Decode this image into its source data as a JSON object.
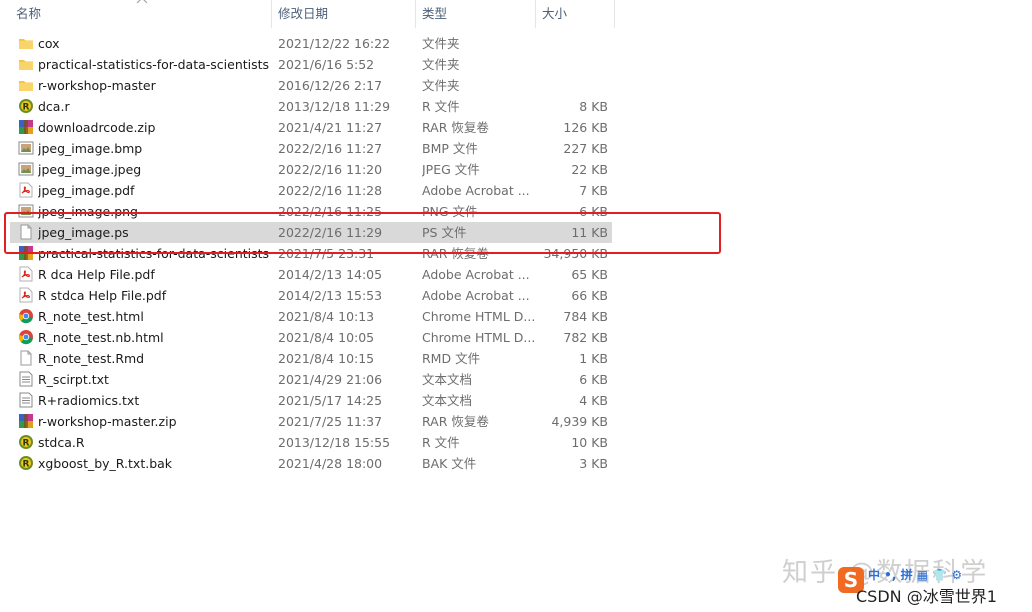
{
  "header": {
    "col_name": "名称",
    "col_date": "修改日期",
    "col_type": "类型",
    "col_size": "大小"
  },
  "files": [
    {
      "name": "cox",
      "date": "2021/12/22 16:22",
      "type": "文件夹",
      "size": "",
      "icon": "folder-icon"
    },
    {
      "name": "practical-statistics-for-data-scientists...",
      "date": "2021/6/16 5:52",
      "type": "文件夹",
      "size": "",
      "icon": "folder-icon"
    },
    {
      "name": "r-workshop-master",
      "date": "2016/12/26 2:17",
      "type": "文件夹",
      "size": "",
      "icon": "folder-icon"
    },
    {
      "name": "dca.r",
      "date": "2013/12/18 11:29",
      "type": "R 文件",
      "size": "8 KB",
      "icon": "r-file-icon"
    },
    {
      "name": "downloadrcode.zip",
      "date": "2021/4/21 11:27",
      "type": "RAR 恢复卷",
      "size": "126 KB",
      "icon": "rar-archive-icon"
    },
    {
      "name": "jpeg_image.bmp",
      "date": "2022/2/16 11:27",
      "type": "BMP 文件",
      "size": "227 KB",
      "icon": "image-file-icon"
    },
    {
      "name": "jpeg_image.jpeg",
      "date": "2022/2/16 11:20",
      "type": "JPEG 文件",
      "size": "22 KB",
      "icon": "image-file-icon"
    },
    {
      "name": "jpeg_image.pdf",
      "date": "2022/2/16 11:28",
      "type": "Adobe Acrobat ...",
      "size": "7 KB",
      "icon": "pdf-file-icon"
    },
    {
      "name": "jpeg_image.png",
      "date": "2022/2/16 11:25",
      "type": "PNG 文件",
      "size": "6 KB",
      "icon": "image-file-icon"
    },
    {
      "name": "jpeg_image.ps",
      "date": "2022/2/16 11:29",
      "type": "PS 文件",
      "size": "11 KB",
      "icon": "blank-file-icon",
      "selected": true
    },
    {
      "name": "practical-statistics-for-data-scientists...",
      "date": "2021/7/5 23:31",
      "type": "RAR 恢复卷",
      "size": "34,950 KB",
      "icon": "rar-archive-icon"
    },
    {
      "name": "R dca Help File.pdf",
      "date": "2014/2/13 14:05",
      "type": "Adobe Acrobat ...",
      "size": "65 KB",
      "icon": "pdf-file-icon"
    },
    {
      "name": "R stdca Help File.pdf",
      "date": "2014/2/13 15:53",
      "type": "Adobe Acrobat ...",
      "size": "66 KB",
      "icon": "pdf-file-icon"
    },
    {
      "name": "R_note_test.html",
      "date": "2021/8/4 10:13",
      "type": "Chrome HTML D...",
      "size": "784 KB",
      "icon": "chrome-html-icon"
    },
    {
      "name": "R_note_test.nb.html",
      "date": "2021/8/4 10:05",
      "type": "Chrome HTML D...",
      "size": "782 KB",
      "icon": "chrome-html-icon"
    },
    {
      "name": "R_note_test.Rmd",
      "date": "2021/8/4 10:15",
      "type": "RMD 文件",
      "size": "1 KB",
      "icon": "blank-file-icon"
    },
    {
      "name": "R_scirpt.txt",
      "date": "2021/4/29 21:06",
      "type": "文本文档",
      "size": "6 KB",
      "icon": "text-file-icon"
    },
    {
      "name": "R+radiomics.txt",
      "date": "2021/5/17 14:25",
      "type": "文本文档",
      "size": "4 KB",
      "icon": "text-file-icon"
    },
    {
      "name": "r-workshop-master.zip",
      "date": "2021/7/25 11:37",
      "type": "RAR 恢复卷",
      "size": "4,939 KB",
      "icon": "rar-archive-icon"
    },
    {
      "name": "stdca.R",
      "date": "2013/12/18 15:55",
      "type": "R 文件",
      "size": "10 KB",
      "icon": "r-file-icon"
    },
    {
      "name": "xgboost_by_R.txt.bak",
      "date": "2021/4/28 18:00",
      "type": "BAK 文件",
      "size": "3 KB",
      "icon": "r-file-icon"
    }
  ],
  "watermark": {
    "zhihu": "知乎 @数据科学",
    "mini": "中 •, 拼 ▦ 👕 ⚙",
    "csdn": "CSDN @冰雪世界1"
  },
  "colors": {
    "selected_row": "#d9d9d9",
    "highlight_border": "#e02020",
    "folder": "#f5c542",
    "header_text": "#4c607a"
  }
}
